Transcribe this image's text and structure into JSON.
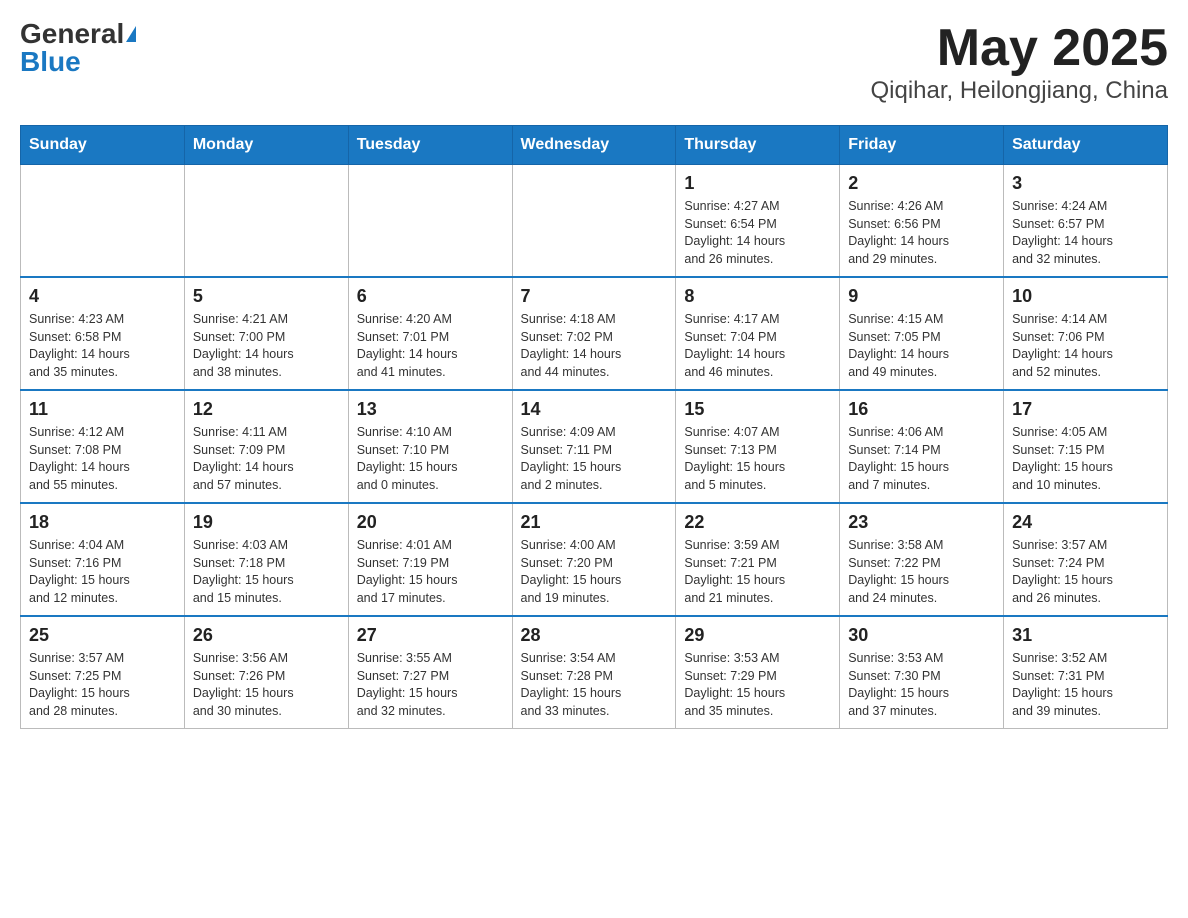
{
  "header": {
    "logo_general": "General",
    "logo_blue": "Blue",
    "month_title": "May 2025",
    "location": "Qiqihar, Heilongjiang, China"
  },
  "days_of_week": [
    "Sunday",
    "Monday",
    "Tuesday",
    "Wednesday",
    "Thursday",
    "Friday",
    "Saturday"
  ],
  "weeks": [
    [
      {
        "day": "",
        "info": ""
      },
      {
        "day": "",
        "info": ""
      },
      {
        "day": "",
        "info": ""
      },
      {
        "day": "",
        "info": ""
      },
      {
        "day": "1",
        "info": "Sunrise: 4:27 AM\nSunset: 6:54 PM\nDaylight: 14 hours\nand 26 minutes."
      },
      {
        "day": "2",
        "info": "Sunrise: 4:26 AM\nSunset: 6:56 PM\nDaylight: 14 hours\nand 29 minutes."
      },
      {
        "day": "3",
        "info": "Sunrise: 4:24 AM\nSunset: 6:57 PM\nDaylight: 14 hours\nand 32 minutes."
      }
    ],
    [
      {
        "day": "4",
        "info": "Sunrise: 4:23 AM\nSunset: 6:58 PM\nDaylight: 14 hours\nand 35 minutes."
      },
      {
        "day": "5",
        "info": "Sunrise: 4:21 AM\nSunset: 7:00 PM\nDaylight: 14 hours\nand 38 minutes."
      },
      {
        "day": "6",
        "info": "Sunrise: 4:20 AM\nSunset: 7:01 PM\nDaylight: 14 hours\nand 41 minutes."
      },
      {
        "day": "7",
        "info": "Sunrise: 4:18 AM\nSunset: 7:02 PM\nDaylight: 14 hours\nand 44 minutes."
      },
      {
        "day": "8",
        "info": "Sunrise: 4:17 AM\nSunset: 7:04 PM\nDaylight: 14 hours\nand 46 minutes."
      },
      {
        "day": "9",
        "info": "Sunrise: 4:15 AM\nSunset: 7:05 PM\nDaylight: 14 hours\nand 49 minutes."
      },
      {
        "day": "10",
        "info": "Sunrise: 4:14 AM\nSunset: 7:06 PM\nDaylight: 14 hours\nand 52 minutes."
      }
    ],
    [
      {
        "day": "11",
        "info": "Sunrise: 4:12 AM\nSunset: 7:08 PM\nDaylight: 14 hours\nand 55 minutes."
      },
      {
        "day": "12",
        "info": "Sunrise: 4:11 AM\nSunset: 7:09 PM\nDaylight: 14 hours\nand 57 minutes."
      },
      {
        "day": "13",
        "info": "Sunrise: 4:10 AM\nSunset: 7:10 PM\nDaylight: 15 hours\nand 0 minutes."
      },
      {
        "day": "14",
        "info": "Sunrise: 4:09 AM\nSunset: 7:11 PM\nDaylight: 15 hours\nand 2 minutes."
      },
      {
        "day": "15",
        "info": "Sunrise: 4:07 AM\nSunset: 7:13 PM\nDaylight: 15 hours\nand 5 minutes."
      },
      {
        "day": "16",
        "info": "Sunrise: 4:06 AM\nSunset: 7:14 PM\nDaylight: 15 hours\nand 7 minutes."
      },
      {
        "day": "17",
        "info": "Sunrise: 4:05 AM\nSunset: 7:15 PM\nDaylight: 15 hours\nand 10 minutes."
      }
    ],
    [
      {
        "day": "18",
        "info": "Sunrise: 4:04 AM\nSunset: 7:16 PM\nDaylight: 15 hours\nand 12 minutes."
      },
      {
        "day": "19",
        "info": "Sunrise: 4:03 AM\nSunset: 7:18 PM\nDaylight: 15 hours\nand 15 minutes."
      },
      {
        "day": "20",
        "info": "Sunrise: 4:01 AM\nSunset: 7:19 PM\nDaylight: 15 hours\nand 17 minutes."
      },
      {
        "day": "21",
        "info": "Sunrise: 4:00 AM\nSunset: 7:20 PM\nDaylight: 15 hours\nand 19 minutes."
      },
      {
        "day": "22",
        "info": "Sunrise: 3:59 AM\nSunset: 7:21 PM\nDaylight: 15 hours\nand 21 minutes."
      },
      {
        "day": "23",
        "info": "Sunrise: 3:58 AM\nSunset: 7:22 PM\nDaylight: 15 hours\nand 24 minutes."
      },
      {
        "day": "24",
        "info": "Sunrise: 3:57 AM\nSunset: 7:24 PM\nDaylight: 15 hours\nand 26 minutes."
      }
    ],
    [
      {
        "day": "25",
        "info": "Sunrise: 3:57 AM\nSunset: 7:25 PM\nDaylight: 15 hours\nand 28 minutes."
      },
      {
        "day": "26",
        "info": "Sunrise: 3:56 AM\nSunset: 7:26 PM\nDaylight: 15 hours\nand 30 minutes."
      },
      {
        "day": "27",
        "info": "Sunrise: 3:55 AM\nSunset: 7:27 PM\nDaylight: 15 hours\nand 32 minutes."
      },
      {
        "day": "28",
        "info": "Sunrise: 3:54 AM\nSunset: 7:28 PM\nDaylight: 15 hours\nand 33 minutes."
      },
      {
        "day": "29",
        "info": "Sunrise: 3:53 AM\nSunset: 7:29 PM\nDaylight: 15 hours\nand 35 minutes."
      },
      {
        "day": "30",
        "info": "Sunrise: 3:53 AM\nSunset: 7:30 PM\nDaylight: 15 hours\nand 37 minutes."
      },
      {
        "day": "31",
        "info": "Sunrise: 3:52 AM\nSunset: 7:31 PM\nDaylight: 15 hours\nand 39 minutes."
      }
    ]
  ]
}
